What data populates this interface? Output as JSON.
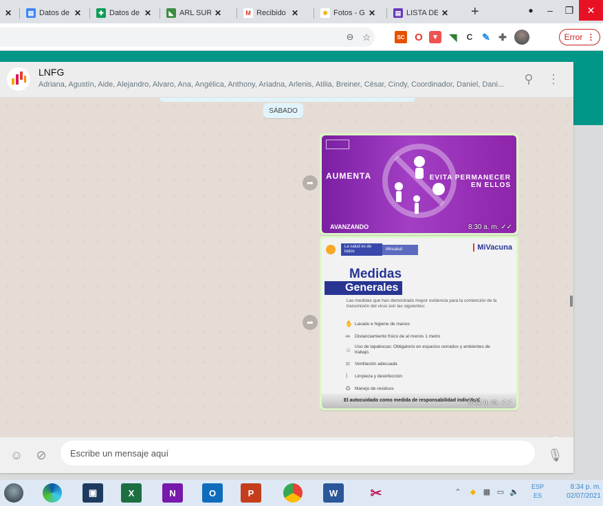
{
  "browser": {
    "tabs": [
      {
        "label": "Datos de",
        "close": "✕",
        "icon": "sheets-icon",
        "color": "#4285f4"
      },
      {
        "label": "Datos de",
        "close": "✕",
        "icon": "forms-icon",
        "color": "#0f9d58"
      },
      {
        "label": "ARL SUR",
        "close": "✕",
        "icon": "arl-icon",
        "color": "#3c8d40"
      },
      {
        "label": "Recibido",
        "close": "✕",
        "icon": "gmail-icon",
        "color": "#d93025"
      },
      {
        "label": "Fotos - G",
        "close": "✕",
        "icon": "photos-icon",
        "color": "#f4b400"
      },
      {
        "label": "LISTA DE",
        "close": "✕",
        "icon": "sheets-icon",
        "color": "#673ab7"
      }
    ],
    "first_tab_close": "✕",
    "new_tab": "+",
    "minimize": "–",
    "restore": "❐",
    "close_window": "✕",
    "extensions": [
      "SC",
      "O",
      "C"
    ],
    "error_button": "Error",
    "error_menu": "⋮"
  },
  "chat": {
    "group_name": "LNFG",
    "members": "Adriana, Agustín, Aide, Alejandro, Alvaro, Ana, Angélica, Anthony, Ariadna, Arlenis, Atilia, Breiner, César, Cindy, Coordinador, Daniel, Dani...",
    "date_chip": "SÁBADO",
    "messages": [
      {
        "time": "8:30 a. m.",
        "image": {
          "headline_left": "AUMENTA",
          "headline_right_1": "EVITA PERMANECER",
          "headline_right_2": "EN ELLOS",
          "footer_text": "AVANZANDO"
        }
      },
      {
        "time": "8:32 a. m.",
        "image": {
          "brand_left": "La salud es de todos",
          "brand_ministry": "Minsalud",
          "brand_right": "MiVacuna",
          "title_1": "Medidas",
          "title_2": "Generales",
          "intro": "Las medidas que han demostrado mayor evidencia para la contención de la transmisión del virus son las siguientes:",
          "items": [
            {
              "text": "Lavado e higiene de manos",
              "icon": "handwash-icon"
            },
            {
              "text": "Distanciamiento físico de al menos 1 metro",
              "icon": "distance-icon"
            },
            {
              "text": "Uso de tapabocas: Obligatorio en espacios cerrados y ambientes de trabajo.",
              "icon": "mask-icon"
            },
            {
              "text": "Ventilación adecuada",
              "icon": "ventilation-icon"
            },
            {
              "text": "Limpieza y desinfección",
              "icon": "cleaning-icon"
            },
            {
              "text": "Manejo de residuos",
              "icon": "waste-icon"
            }
          ],
          "footer": "El autocuidado como medida de responsabilidad individual"
        }
      }
    ],
    "composer": {
      "placeholder": "Escribe un mensaje aquí"
    }
  },
  "taskbar": {
    "apps": [
      "Edge",
      "Explorer",
      "Excel",
      "OneNote",
      "Outlook",
      "PowerPoint",
      "Chrome",
      "Word",
      "Snipping"
    ],
    "tray": {
      "lang_top": "ESP",
      "lang_bottom": "ES",
      "time": "8:34 p. m.",
      "date": "02/07/2021"
    }
  },
  "colors": {
    "teal": "#009688",
    "chat_bg": "#e5ddd5",
    "bubble": "#dcf8c6"
  }
}
